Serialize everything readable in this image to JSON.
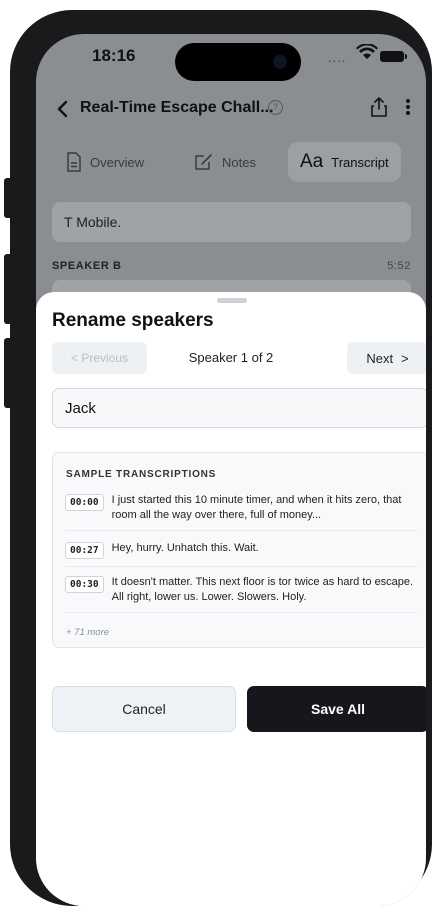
{
  "status_bar": {
    "time": "18:16",
    "signal": "...."
  },
  "nav": {
    "title": "Real-Time Escape Chall...",
    "info_icon_glyph": "?"
  },
  "tabs": [
    {
      "label": "Overview",
      "icon": "document-icon"
    },
    {
      "label": "Notes",
      "icon": "edit-icon"
    },
    {
      "label": "Transcript",
      "icon": "aa-icon",
      "glyph": "Aa",
      "active": true
    }
  ],
  "transcript": {
    "bubble_text": "T Mobile.",
    "speaker_label": "SPEAKER B",
    "speaker_time": "5:52"
  },
  "sheet": {
    "title": "Rename speakers",
    "previous_label": "< Previous",
    "speaker_counter": "Speaker 1 of 2",
    "next_label": "Next",
    "next_chevron": ">",
    "name_value": "Jack",
    "samples_header": "SAMPLE TRANSCRIPTIONS",
    "samples": [
      {
        "time": "00:00",
        "text": "I just started this 10 minute timer, and when it hits zero, that room all the way over there, full of money..."
      },
      {
        "time": "00:27",
        "text": "Hey, hurry. Unhatch this. Wait."
      },
      {
        "time": "00:30",
        "text": "It doesn't matter. This next floor is tor twice as hard to escape. All right, lower us. Lower. Slowers. Holy."
      }
    ],
    "more_count": "+ 71 more",
    "cancel_label": "Cancel",
    "save_label": "Save All"
  },
  "colors": {
    "dim_overlay": "#8a8d91",
    "sheet_bg": "#ffffff",
    "primary_button": "#15171c",
    "secondary_button": "#eef1f5"
  }
}
